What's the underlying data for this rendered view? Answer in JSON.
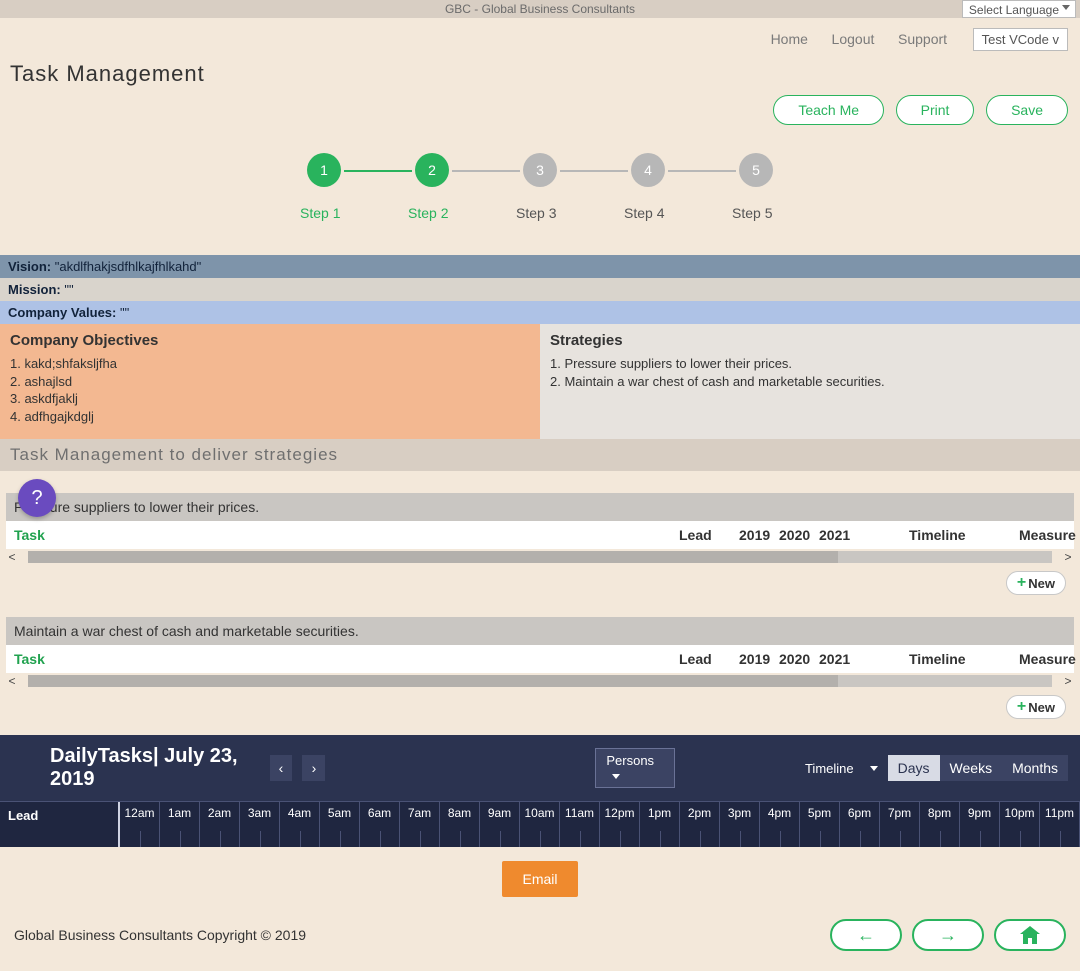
{
  "topbar": {
    "title": "GBC - Global Business Consultants",
    "language": "Select Language"
  },
  "nav": {
    "home": "Home",
    "logout": "Logout",
    "support": "Support",
    "vcode": "Test VCode   v"
  },
  "page_title": "Task Management",
  "actions": {
    "teach": "Teach Me",
    "print": "Print",
    "save": "Save"
  },
  "steps": [
    {
      "num": "1",
      "label": "Step 1",
      "active": true
    },
    {
      "num": "2",
      "label": "Step 2",
      "active": true
    },
    {
      "num": "3",
      "label": "Step 3",
      "active": false
    },
    {
      "num": "4",
      "label": "Step 4",
      "active": false
    },
    {
      "num": "5",
      "label": "Step 5",
      "active": false
    }
  ],
  "bands": {
    "vision_label": "Vision:",
    "vision_value": " \"akdlfhakjsdfhlkajfhlkahd\"",
    "mission_label": "Mission:",
    "mission_value": " \"\"",
    "values_label": "Company Values:",
    "values_value": " \"\""
  },
  "objectives": {
    "title": "Company Objectives",
    "items": [
      "1. kakd;shfaksljfha",
      "2. ashajlsd",
      "3. askdfjaklj",
      "4. adfhgajkdglj"
    ]
  },
  "strategies": {
    "title": "Strategies",
    "items": [
      "1. Pressure suppliers to lower their prices.",
      "2. Maintain a war chest of cash and marketable securities."
    ]
  },
  "deliver_title": "Task Management to deliver strategies",
  "strategy_blocks": [
    {
      "head": "Pressure suppliers to lower their prices.",
      "show_help": true
    },
    {
      "head": "Maintain a war chest of cash and marketable securities.",
      "show_help": false
    }
  ],
  "grid": {
    "task": "Task",
    "lead": "Lead",
    "y1": "2019",
    "y2": "2020",
    "y3": "2021",
    "timeline": "Timeline",
    "measure": "Measure",
    "new": "New",
    "plus": "+"
  },
  "help_q": "?",
  "daily": {
    "title": "DailyTasks| July 23, 2019",
    "persons": "Persons",
    "timeline": "Timeline",
    "views": {
      "days": "Days",
      "weeks": "Weeks",
      "months": "Months"
    },
    "lead": "Lead",
    "hours": [
      "12am",
      "1am",
      "2am",
      "3am",
      "4am",
      "5am",
      "6am",
      "7am",
      "8am",
      "9am",
      "10am",
      "11am",
      "12pm",
      "1pm",
      "2pm",
      "3pm",
      "4pm",
      "5pm",
      "6pm",
      "7pm",
      "8pm",
      "9pm",
      "10pm",
      "11pm"
    ]
  },
  "email": "Email",
  "copyright": "Global Business Consultants Copyright © 2019"
}
